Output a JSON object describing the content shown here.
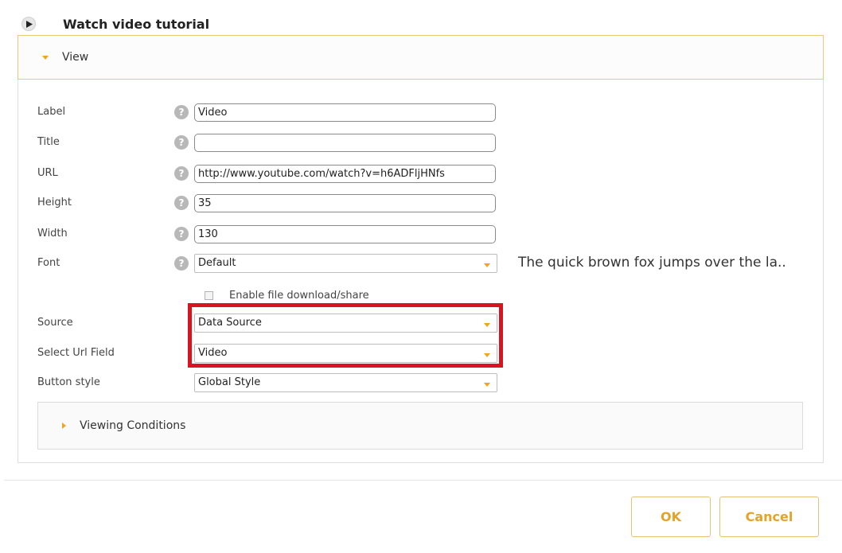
{
  "header": {
    "title": "Watch video tutorial"
  },
  "view_section": {
    "label": "View"
  },
  "fields": {
    "label": {
      "label": "Label",
      "value": "Video"
    },
    "title": {
      "label": "Title",
      "value": ""
    },
    "url": {
      "label": "URL",
      "value": "http://www.youtube.com/watch?v=h6ADFljHNfs"
    },
    "height": {
      "label": "Height",
      "value": "35"
    },
    "width": {
      "label": "Width",
      "value": "130"
    },
    "font": {
      "label": "Font",
      "value": "Default",
      "sample": "The quick brown fox jumps over the la.."
    },
    "enable_download": {
      "label": "Enable file download/share",
      "checked": false
    },
    "source": {
      "label": "Source",
      "value": "Data Source"
    },
    "url_field": {
      "label": "Select Url Field",
      "value": "Video"
    },
    "button_style": {
      "label": "Button style",
      "value": "Global Style"
    }
  },
  "help_glyph": "?",
  "viewing_conditions": {
    "label": "Viewing Conditions"
  },
  "buttons": {
    "ok": "OK",
    "cancel": "Cancel"
  },
  "colors": {
    "accent": "#f0a51d",
    "highlight": "#d7141f",
    "section_border": "#e8c97a"
  },
  "icons": [
    "play-icon",
    "caret-down-icon",
    "help-icon",
    "dropdown-arrow-icon",
    "caret-right-icon"
  ]
}
